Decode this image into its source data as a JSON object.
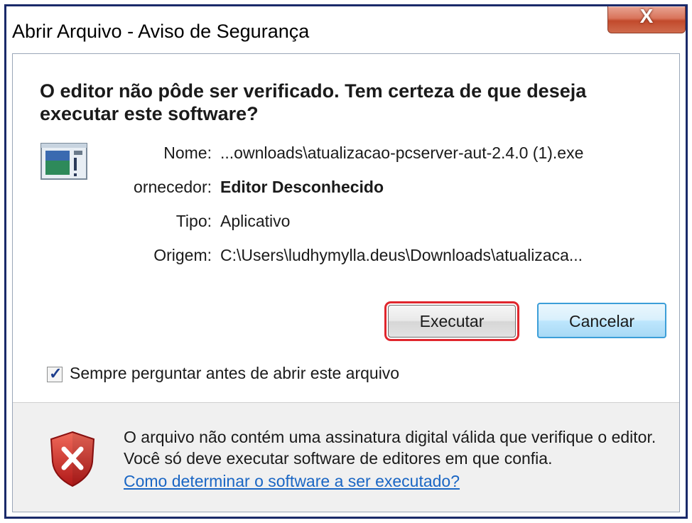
{
  "window": {
    "title": "Abrir Arquivo - Aviso de Segurança",
    "close_label": "X"
  },
  "dialog": {
    "headline": "O editor não pôde ser verificado. Tem certeza de que deseja executar este software?",
    "fields": [
      {
        "label": "Nome:",
        "value": "...ownloads\\atualizacao-pcserver-aut-2.4.0 (1).exe"
      },
      {
        "label": "ornecedor:",
        "value": "Editor Desconhecido"
      },
      {
        "label": "Tipo:",
        "value": "Aplicativo"
      },
      {
        "label": "Origem:",
        "value": "C:\\Users\\ludhymylla.deus\\Downloads\\atualizaca..."
      }
    ],
    "buttons": {
      "execute": "Executar",
      "cancel": "Cancelar"
    },
    "checkbox": {
      "label": "Sempre perguntar antes de abrir este arquivo",
      "checked": true,
      "check_glyph": "✓"
    },
    "warning": {
      "text": "O arquivo não contém uma assinatura digital válida que verifique o editor. Você só deve executar software de editores em que confia.",
      "link": "Como determinar o software a ser executado?"
    }
  },
  "icons": {
    "app": "application-icon",
    "shield": "security-shield-error-icon"
  },
  "colors": {
    "highlight_border": "#e0262d",
    "link": "#1a66c4",
    "frame": "#1a2a6a"
  }
}
